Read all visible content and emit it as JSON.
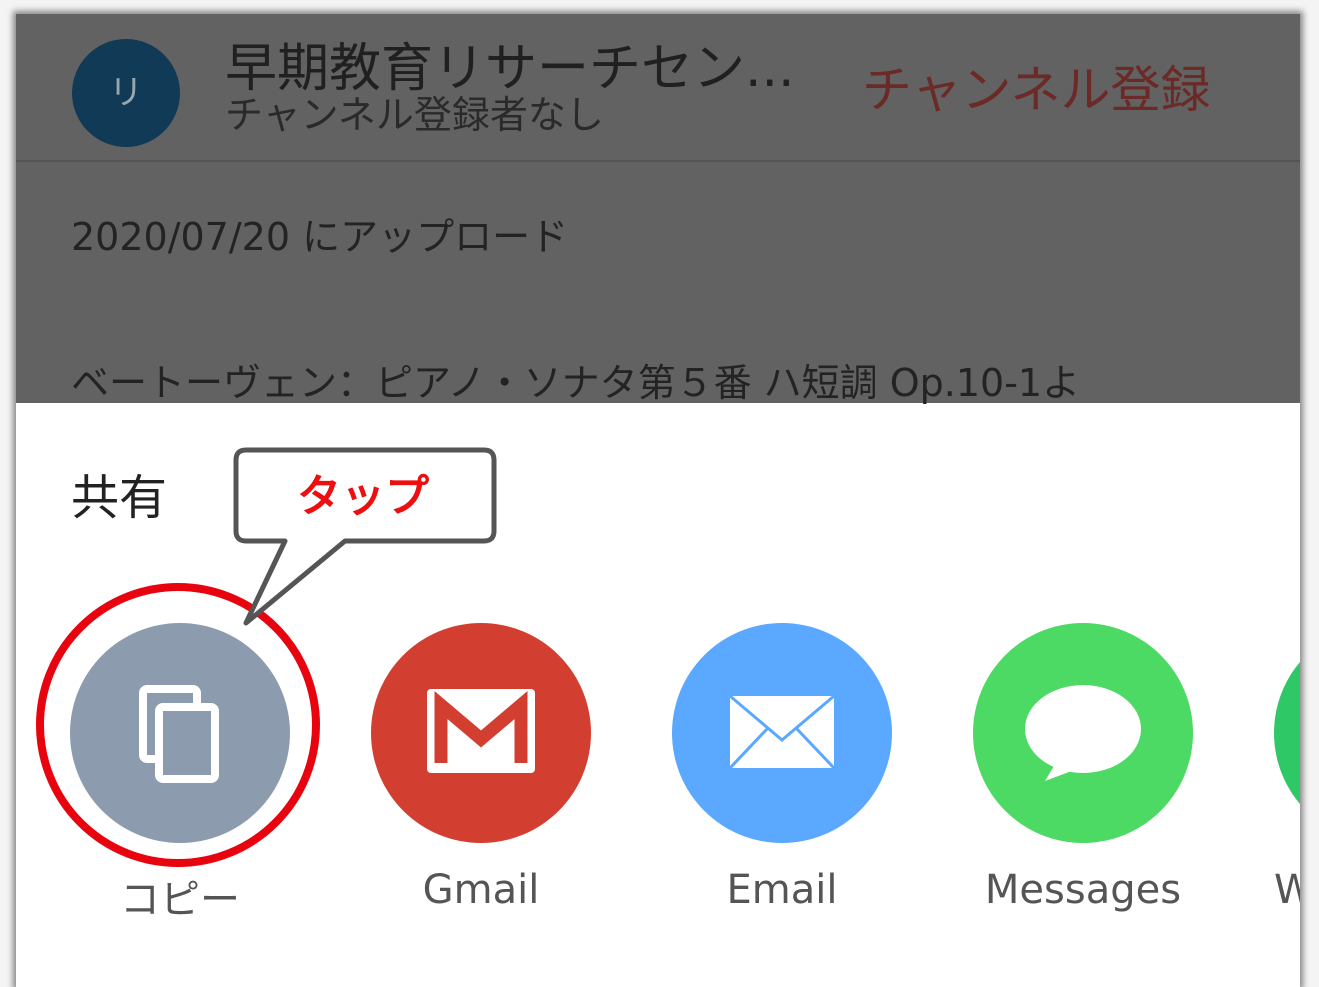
{
  "channel": {
    "avatar_initial": "リ",
    "name": "早期教育リサーチセン...",
    "subscribers": "チャンネル登録者なし",
    "subscribe_label": "チャンネル登録"
  },
  "video": {
    "upload_date": "2020/07/20 にアップロード",
    "description": "ベートーヴェン：ピアノ・ソナタ第５番 ハ短調 Op.10-1よ"
  },
  "share_sheet": {
    "title": "共有",
    "targets": [
      {
        "label": "コピー",
        "icon": "copy-icon",
        "color": "#8c9cae"
      },
      {
        "label": "Gmail",
        "icon": "gmail-icon",
        "color": "#d23f31"
      },
      {
        "label": "Email",
        "icon": "envelope-icon",
        "color": "#5aa8ff"
      },
      {
        "label": "Messages",
        "icon": "speech-bubble-icon",
        "color": "#4cd964"
      },
      {
        "label": "W",
        "icon": "partial-app-icon",
        "color": "#2ec866"
      }
    ]
  },
  "annotation": {
    "callout_text": "タップ",
    "highlight_color": "#e8040f"
  }
}
